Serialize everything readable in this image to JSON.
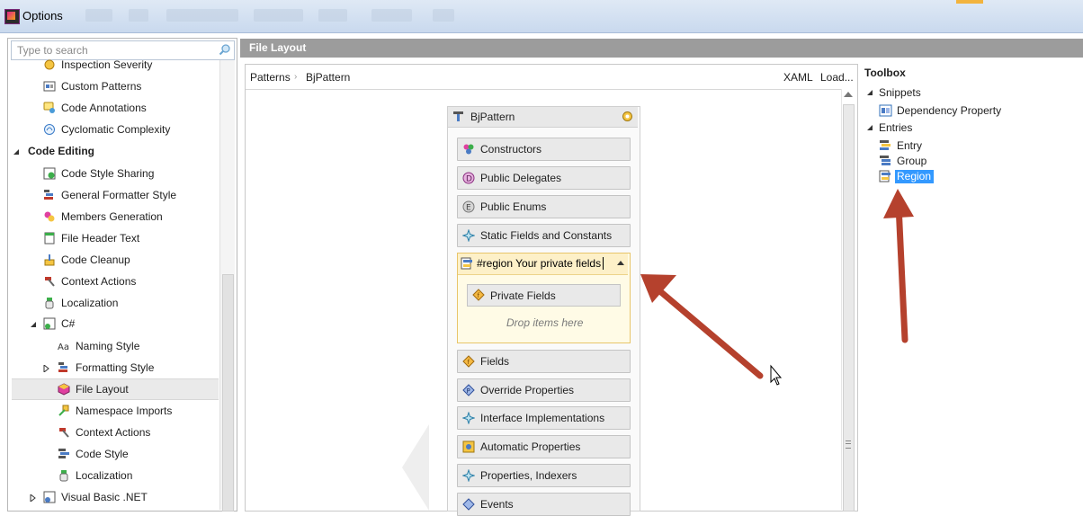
{
  "window": {
    "title": "Options"
  },
  "search": {
    "placeholder": "Type to search"
  },
  "tree": {
    "items": [
      {
        "label": "Inspection Severity"
      },
      {
        "label": "Custom Patterns"
      },
      {
        "label": "Code Annotations"
      },
      {
        "label": "Cyclomatic Complexity"
      },
      {
        "label": "Code Editing"
      },
      {
        "label": "Code Style Sharing"
      },
      {
        "label": "General Formatter Style"
      },
      {
        "label": "Members Generation"
      },
      {
        "label": "File Header Text"
      },
      {
        "label": "Code Cleanup"
      },
      {
        "label": "Context Actions"
      },
      {
        "label": "Localization"
      },
      {
        "label": "C#"
      },
      {
        "label": "Naming Style"
      },
      {
        "label": "Formatting Style"
      },
      {
        "label": "File Layout"
      },
      {
        "label": "Namespace Imports"
      },
      {
        "label": "Context Actions"
      },
      {
        "label": "Code Style"
      },
      {
        "label": "Localization"
      },
      {
        "label": "Visual Basic .NET"
      }
    ],
    "selected": "File Layout"
  },
  "panel": {
    "title": "File Layout"
  },
  "breadcrumb": {
    "root": "Patterns",
    "current": "BjPattern"
  },
  "toolbar": {
    "xaml": "XAML",
    "load": "Load..."
  },
  "pattern": {
    "name": "BjPattern",
    "entries_top": [
      {
        "label": "Constructors"
      },
      {
        "label": "Public Delegates"
      },
      {
        "label": "Public Enums"
      },
      {
        "label": "Static Fields and Constants"
      }
    ],
    "region": {
      "value": "#region Your private fields",
      "child": "Private Fields",
      "drop_hint": "Drop items here"
    },
    "entries_bottom": [
      {
        "label": "Fields"
      },
      {
        "label": "Override Properties"
      },
      {
        "label": "Interface Implementations"
      },
      {
        "label": "Automatic Properties"
      },
      {
        "label": "Properties, Indexers"
      },
      {
        "label": "Events"
      }
    ]
  },
  "toolbox": {
    "title": "Toolbox",
    "snippets": {
      "label": "Snippets",
      "items": [
        "Dependency Property"
      ]
    },
    "entries": {
      "label": "Entries",
      "items": [
        "Entry",
        "Group",
        "Region"
      ]
    },
    "selected": "Region"
  },
  "colors": {
    "selection": "#3399ff",
    "annotation_arrow": "#b5412d",
    "header_bar": "#9c9c9c",
    "region_border": "#e8c56a"
  }
}
